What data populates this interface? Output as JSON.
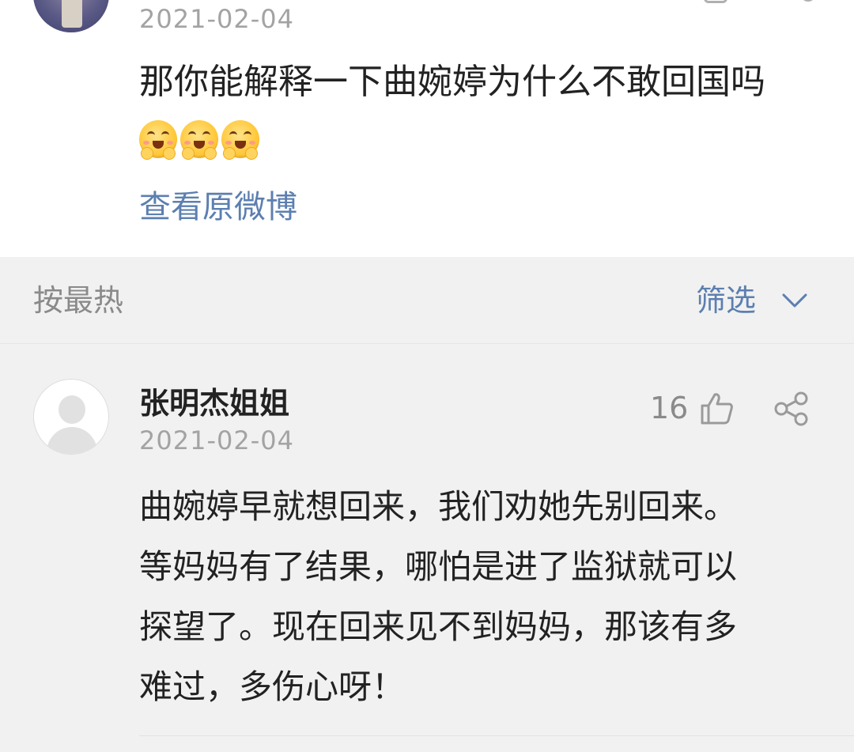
{
  "previous_comment": {
    "date": "2021-02-04",
    "text": "那你能解释一下曲婉婷为什么不敢回国吗",
    "emoji_count": 3,
    "view_original_label": "查看原微博"
  },
  "sort_bar": {
    "sort_label": "按最热",
    "filter_label": "筛选"
  },
  "comment": {
    "username": "张明杰姐姐",
    "date": "2021-02-04",
    "like_count": "16",
    "text_lines": [
      "曲婉婷早就想回来，我们劝她先别回来。",
      "等妈妈有了结果，哪怕是进了监狱就可以",
      "探望了。现在回来见不到妈妈，那该有多",
      "难过，多伤心呀！"
    ]
  },
  "colors": {
    "link_blue": "#5c7fb0",
    "muted_gray": "#a3a3a3",
    "text_dark": "#222222",
    "background": "#f1f1f1"
  },
  "icons": [
    "chevron-down-icon",
    "like-icon",
    "share-icon",
    "grin-emoji-icon"
  ]
}
